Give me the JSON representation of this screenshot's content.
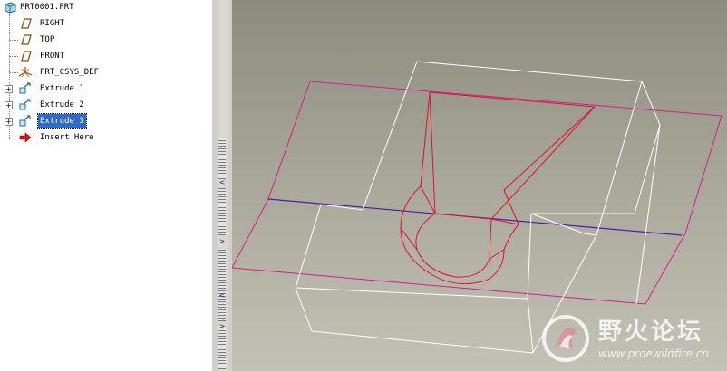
{
  "model_tree": {
    "root": {
      "label": "PRT0001.PRT",
      "icon": "part-icon"
    },
    "items": [
      {
        "label": "RIGHT",
        "icon": "datum-plane-icon",
        "expandable": false,
        "selected": false
      },
      {
        "label": "TOP",
        "icon": "datum-plane-icon",
        "expandable": false,
        "selected": false
      },
      {
        "label": "FRONT",
        "icon": "datum-plane-icon",
        "expandable": false,
        "selected": false
      },
      {
        "label": "PRT_CSYS_DEF",
        "icon": "coordinate-system-icon",
        "expandable": false,
        "selected": false
      },
      {
        "label": "Extrude 1",
        "icon": "extrude-icon",
        "expandable": true,
        "selected": false
      },
      {
        "label": "Extrude 2",
        "icon": "extrude-icon",
        "expandable": true,
        "selected": false
      },
      {
        "label": "Extrude 3",
        "icon": "extrude-icon",
        "expandable": true,
        "selected": true
      },
      {
        "label": "Insert Here",
        "icon": "insert-arrow-icon",
        "expandable": false,
        "selected": false
      }
    ]
  },
  "splitter": {
    "arrows": [
      "<",
      ">",
      "<",
      ">"
    ]
  },
  "viewport": {
    "colors": {
      "datum_plane": "#d0208a",
      "model_edges": "#ffffff",
      "sketch": "#e01030",
      "datum_axis_line": "#4a1aa8"
    }
  },
  "watermark": {
    "title": "野火论坛",
    "url": "www.proewildfire.cn"
  }
}
